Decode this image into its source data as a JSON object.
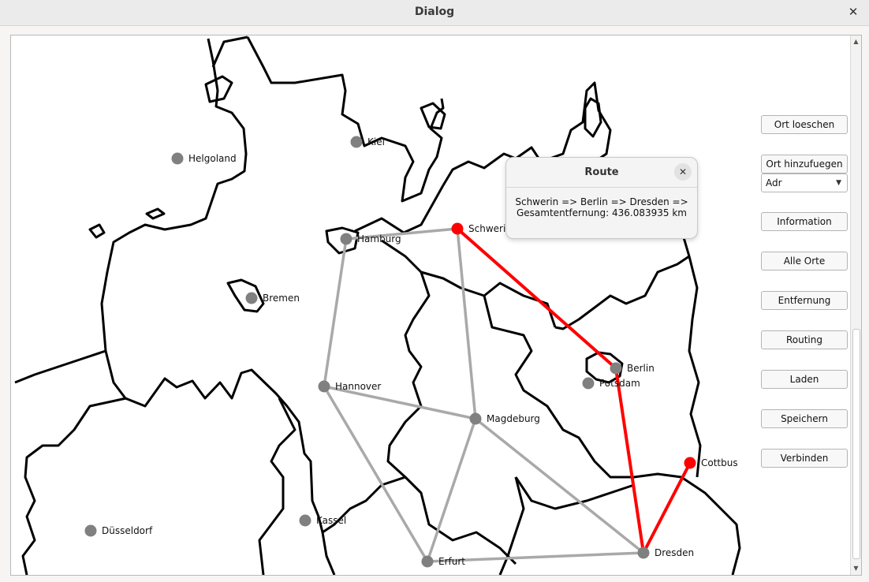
{
  "window": {
    "title": "Dialog",
    "close_icon": "close-icon"
  },
  "nodes": [
    {
      "name": "Helgoland",
      "color": "#808080"
    },
    {
      "name": "Kiel",
      "color": "#808080"
    },
    {
      "name": "Hamburg",
      "color": "#808080"
    },
    {
      "name": "Schwerin",
      "color": "#ff0000"
    },
    {
      "name": "Bremen",
      "color": "#808080"
    },
    {
      "name": "Berlin",
      "color": "#808080"
    },
    {
      "name": "Potsdam",
      "color": "#808080"
    },
    {
      "name": "Hannover",
      "color": "#808080"
    },
    {
      "name": "Magdeburg",
      "color": "#808080"
    },
    {
      "name": "Cottbus",
      "color": "#ff0000"
    },
    {
      "name": "Düsseldorf",
      "color": "#808080"
    },
    {
      "name": "Kassel",
      "color": "#808080"
    },
    {
      "name": "Erfurt",
      "color": "#808080"
    },
    {
      "name": "Dresden",
      "color": "#808080"
    }
  ],
  "edges": [
    {
      "from": "Hamburg",
      "to": "Schwerin",
      "route": false
    },
    {
      "from": "Hamburg",
      "to": "Hannover",
      "route": false
    },
    {
      "from": "Schwerin",
      "to": "Magdeburg",
      "route": false
    },
    {
      "from": "Hannover",
      "to": "Magdeburg",
      "route": false
    },
    {
      "from": "Hannover",
      "to": "Erfurt",
      "route": false
    },
    {
      "from": "Magdeburg",
      "to": "Erfurt",
      "route": false
    },
    {
      "from": "Magdeburg",
      "to": "Dresden",
      "route": false
    },
    {
      "from": "Erfurt",
      "to": "Dresden",
      "route": false
    },
    {
      "from": "Schwerin",
      "to": "Berlin",
      "route": true
    },
    {
      "from": "Berlin",
      "to": "Dresden",
      "route": true
    },
    {
      "from": "Dresden",
      "to": "Cottbus",
      "route": true
    }
  ],
  "colors": {
    "edge": "#a9a9a9",
    "route": "#ff0000",
    "border": "#000000"
  },
  "buttons": {
    "ort_loeschen": "Ort loeschen",
    "ort_hinzufuegen": "Ort hinzufuegen",
    "information": "Information",
    "alle_orte": "Alle Orte",
    "entfernung": "Entfernung",
    "routing": "Routing",
    "laden": "Laden",
    "speichern": "Speichern",
    "verbinden": "Verbinden"
  },
  "type_select": {
    "value": "Adr"
  },
  "route_popup": {
    "title": "Route",
    "line1": "Schwerin => Berlin => Dresden =>",
    "line2": "Gesamtentfernung: 436.083935 km"
  }
}
